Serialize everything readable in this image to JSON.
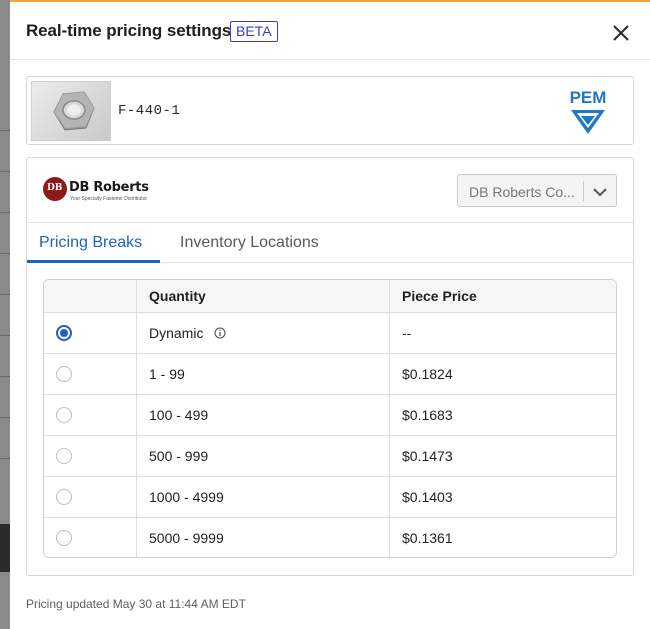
{
  "dialog": {
    "title": "Real-time pricing settings",
    "badge": "BETA",
    "close_icon": "close-icon"
  },
  "product": {
    "part_number": "F-440-1",
    "thumbnail_icon": "hex-nut-image",
    "brand_logo": "PEM"
  },
  "distributor": {
    "logo_name": "DB Roberts",
    "logo_tagline": "Your Specialty Fastener Distributor",
    "logo_mark": "DB",
    "select_value": "DB Roberts Co...",
    "select_icon": "chevron-down-icon"
  },
  "tabs": [
    {
      "label": "Pricing Breaks",
      "active": true
    },
    {
      "label": "Inventory Locations",
      "active": false
    }
  ],
  "table": {
    "headers": [
      "",
      "Quantity",
      "Piece Price"
    ],
    "rows": [
      {
        "quantity": "Dynamic",
        "price": "--",
        "selected": true,
        "has_info": true
      },
      {
        "quantity": "1 - 99",
        "price": "$0.1824",
        "selected": false
      },
      {
        "quantity": "100 - 499",
        "price": "$0.1683",
        "selected": false
      },
      {
        "quantity": "500 - 999",
        "price": "$0.1473",
        "selected": false
      },
      {
        "quantity": "1000 - 4999",
        "price": "$0.1403",
        "selected": false
      },
      {
        "quantity": "5000 - 9999",
        "price": "$0.1361",
        "selected": false
      }
    ]
  },
  "footer": {
    "updated_text": "Pricing updated May 30 at 11:44 AM EDT"
  },
  "colors": {
    "accent": "#1f5fc8",
    "badge": "#3a3dc4",
    "top_border": "#f0a53a",
    "brand_blue": "#1f78c8",
    "distributor_red": "#8b1a1a"
  }
}
